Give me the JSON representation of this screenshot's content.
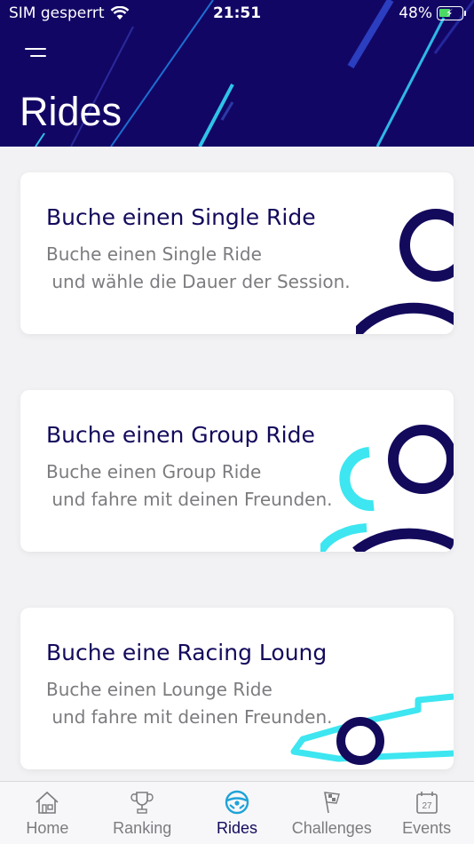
{
  "status_bar": {
    "carrier": "SIM gesperrt",
    "time": "21:51",
    "battery": "48%",
    "battery_level": 0.48
  },
  "header": {
    "title": "Rides",
    "menu_icon": "hamburger-menu-icon"
  },
  "cards": [
    {
      "title": "Buche einen Single Ride",
      "description": "Buche einen Single Ride\n und wähle die Dauer der Session.",
      "illustration": "single-person-icon"
    },
    {
      "title": "Buche einen Group Ride",
      "description": "Buche einen Group Ride\n und fahre mit deinen Freunden.",
      "illustration": "group-persons-icon"
    },
    {
      "title": "Buche eine Racing Loung",
      "description": "Buche einen Lounge Ride\n und fahre mit deinen Freunden.",
      "illustration": "race-car-icon"
    }
  ],
  "tabbar": {
    "tabs": [
      {
        "label": "Home",
        "icon": "home-icon",
        "active": false
      },
      {
        "label": "Ranking",
        "icon": "trophy-icon",
        "active": false
      },
      {
        "label": "Rides",
        "icon": "steering-wheel-icon",
        "active": true
      },
      {
        "label": "Challenges",
        "icon": "checkered-flag-icon",
        "active": false
      },
      {
        "label": "Events",
        "icon": "calendar-icon",
        "active": false,
        "badge": "27"
      }
    ]
  },
  "colors": {
    "header_bg": "#120665",
    "accent_navy": "#130a5c",
    "accent_cyan": "#3de6f0",
    "active_tab_icon": "#1fa3d8",
    "inactive_gray": "#7c7c80"
  }
}
